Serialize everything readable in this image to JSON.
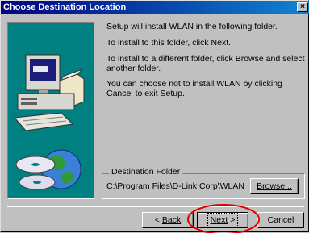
{
  "window": {
    "title": "Choose Destination Location",
    "close_glyph": "×"
  },
  "body": {
    "p1": "Setup will install WLAN in the following folder.",
    "p2": "To install to this folder, click Next.",
    "p3": "To install to a different folder, click Browse and select another folder.",
    "p4": "You can choose not to install WLAN by clicking Cancel to exit Setup."
  },
  "destination": {
    "legend": "Destination Folder",
    "path": "C:\\Program Files\\D-Link Corp\\WLAN",
    "browse_label": "Browse..."
  },
  "buttons": {
    "back_prefix": "<",
    "back_label": "Back",
    "next_label": "Next",
    "next_suffix": ">",
    "cancel_label": "Cancel"
  },
  "colors": {
    "title_gradient_start": "#000080",
    "title_gradient_end": "#1084d0",
    "annotation_circle": "#e00000"
  }
}
